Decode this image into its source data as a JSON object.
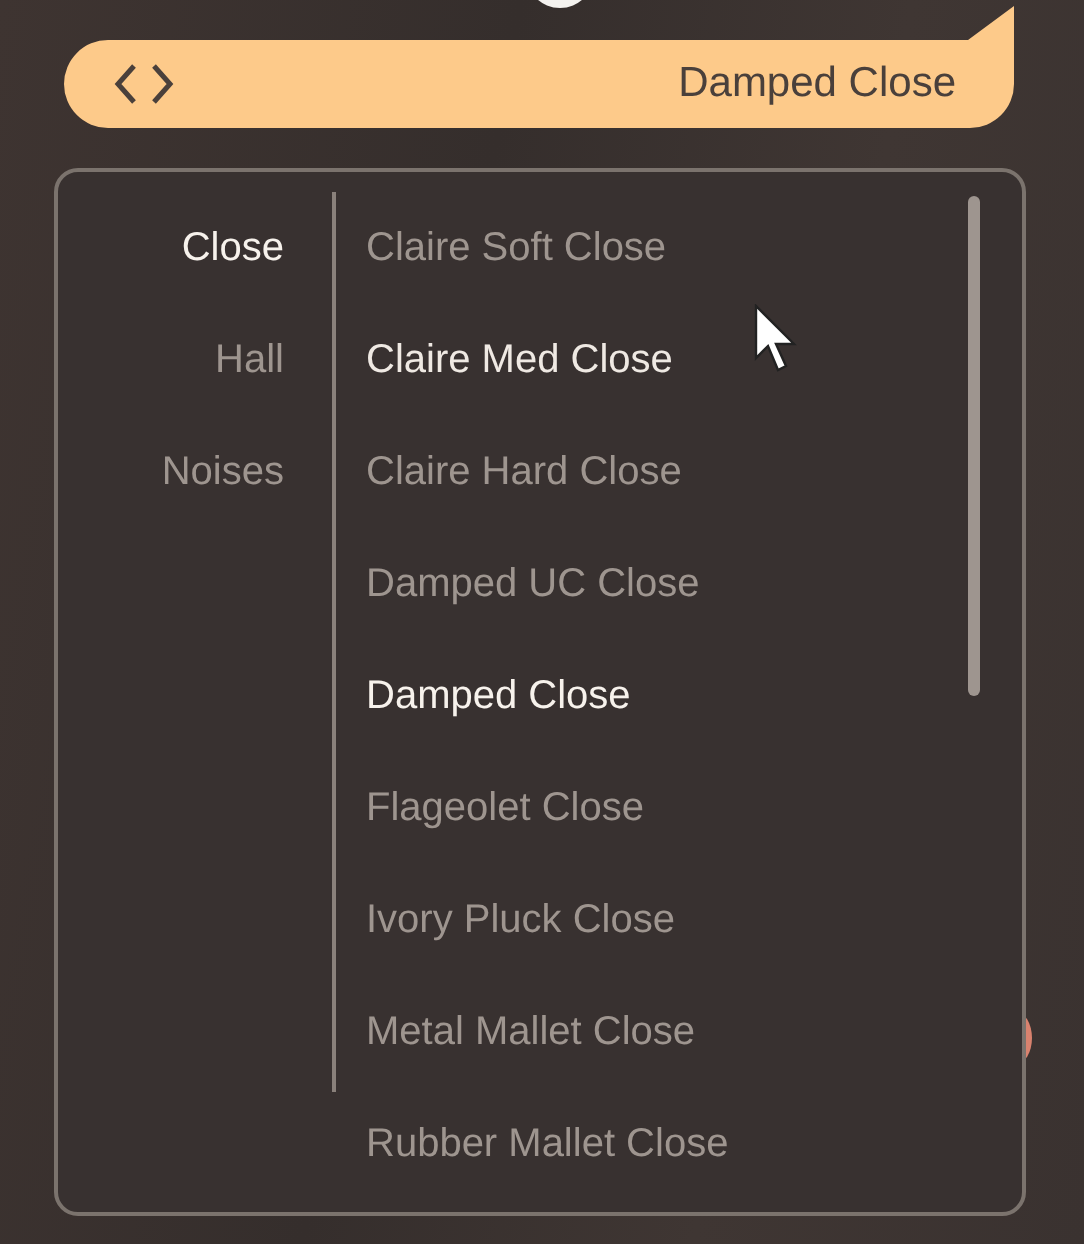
{
  "preset_bar": {
    "title": "Damped Close"
  },
  "categories": [
    {
      "label": "Close",
      "selected": true
    },
    {
      "label": "Hall",
      "selected": false
    },
    {
      "label": "Noises",
      "selected": false
    }
  ],
  "presets": [
    {
      "label": "Claire Soft Close",
      "selected": false,
      "hovered": false
    },
    {
      "label": "Claire Med Close",
      "selected": false,
      "hovered": true
    },
    {
      "label": "Claire Hard Close",
      "selected": false,
      "hovered": false
    },
    {
      "label": "Damped UC Close",
      "selected": false,
      "hovered": false
    },
    {
      "label": "Damped Close",
      "selected": true,
      "hovered": false
    },
    {
      "label": "Flageolet Close",
      "selected": false,
      "hovered": false
    },
    {
      "label": "Ivory Pluck Close",
      "selected": false,
      "hovered": false
    },
    {
      "label": "Metal Mallet Close",
      "selected": false,
      "hovered": false
    },
    {
      "label": "Rubber Mallet Close",
      "selected": false,
      "hovered": false
    }
  ]
}
